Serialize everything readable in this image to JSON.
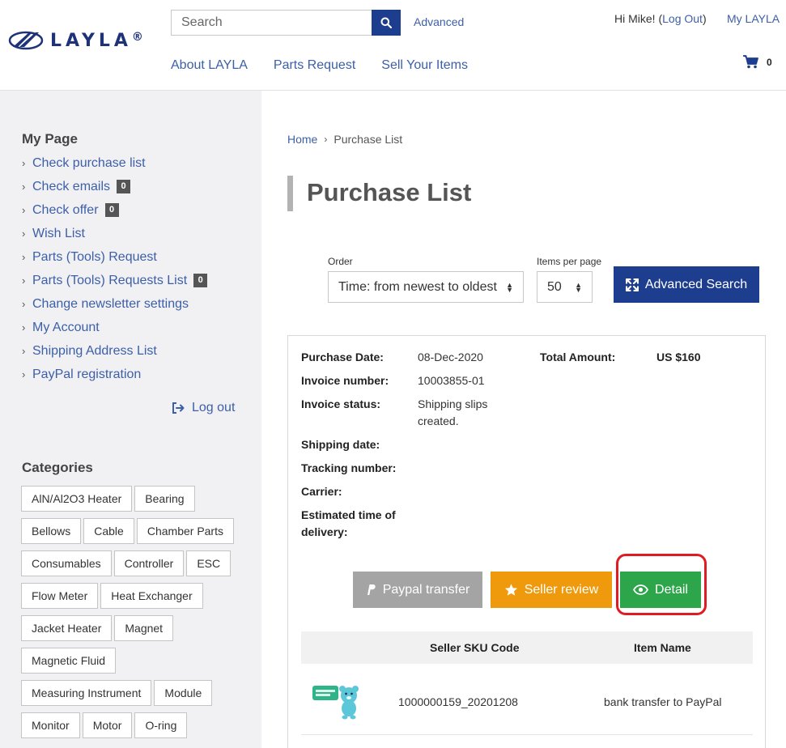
{
  "header": {
    "logo_text": "LAYLA",
    "logo_mark": "®",
    "search_placeholder": "Search",
    "advanced_label": "Advanced",
    "nav": [
      "About LAYLA",
      "Parts Request",
      "Sell Your Items"
    ],
    "greeting_prefix": "Hi Mike! (",
    "logout_label": "Log Out",
    "greeting_suffix": ")",
    "my_layla_label": "My LAYLA",
    "cart_count": "0"
  },
  "sidebar": {
    "my_page_title": "My Page",
    "items": [
      {
        "label": "Check purchase list",
        "badge": ""
      },
      {
        "label": "Check emails",
        "badge": "0"
      },
      {
        "label": "Check offer",
        "badge": "0"
      },
      {
        "label": "Wish List",
        "badge": ""
      },
      {
        "label": "Parts (Tools) Request",
        "badge": ""
      },
      {
        "label": "Parts (Tools) Requests List",
        "badge": "0"
      },
      {
        "label": "Change newsletter settings",
        "badge": ""
      },
      {
        "label": "My Account",
        "badge": ""
      },
      {
        "label": "Shipping Address List",
        "badge": ""
      },
      {
        "label": "PayPal registration",
        "badge": ""
      }
    ],
    "logout_label": "Log out",
    "categories_title": "Categories",
    "categories": [
      "AlN/Al2O3 Heater",
      "Bearing",
      "Bellows",
      "Cable",
      "Chamber Parts",
      "Consumables",
      "Controller",
      "ESC",
      "Flow Meter",
      "Heat Exchanger",
      "Jacket Heater",
      "Magnet",
      "Magnetic Fluid",
      "Measuring Instrument",
      "Module",
      "Monitor",
      "Motor",
      "O-ring"
    ]
  },
  "main": {
    "breadcrumb": {
      "home": "Home",
      "current": "Purchase List"
    },
    "title": "Purchase List",
    "order_label": "Order",
    "order_value": "Time: from newest to oldest",
    "per_page_label": "Items per page",
    "per_page_value": "50",
    "advanced_search_label": "Advanced Search",
    "purchase": {
      "purchase_date_label": "Purchase Date:",
      "purchase_date": "08-Dec-2020",
      "total_label": "Total Amount:",
      "total": "US $160",
      "invoice_number_label": "Invoice number:",
      "invoice_number": "10003855-01",
      "invoice_status_label": "Invoice status:",
      "invoice_status_line1": "Shipping slips",
      "invoice_status_line2": "created.",
      "shipping_date_label": "Shipping date:",
      "tracking_label": "Tracking number:",
      "carrier_label": "Carrier:",
      "eta_label_line1": "Estimated time of",
      "eta_label_line2": "delivery:"
    },
    "buttons": {
      "paypal": "Paypal transfer",
      "review": "Seller review",
      "detail": "Detail"
    },
    "table": {
      "headers": [
        "Seller SKU Code",
        "Item Name"
      ],
      "rows": [
        {
          "sku": "1000000159_20201208",
          "name": "bank transfer to PayPal"
        }
      ]
    }
  },
  "colors": {
    "brand": "#1d3d8f",
    "link": "#3c5fa8",
    "detail": "#2da64b",
    "review": "#ef9a0c",
    "paypal": "#a4a4a4",
    "highlight": "#e11b22"
  }
}
